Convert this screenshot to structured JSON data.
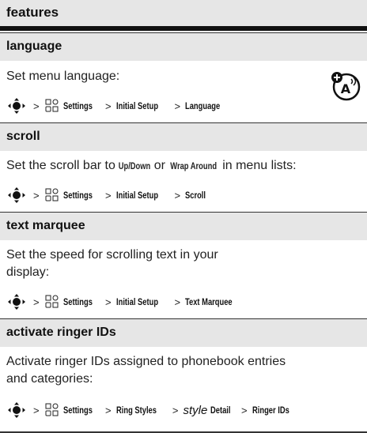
{
  "header": {
    "title": "features"
  },
  "sections": [
    {
      "title": "language",
      "desc": "Set menu language:",
      "path": [
        "Settings",
        "Initial Setup",
        "Language"
      ]
    },
    {
      "title": "scroll",
      "desc_before": "Set the scroll bar to ",
      "desc_opt1": "Up/Down",
      "desc_mid": " or ",
      "desc_opt2": "Wrap Around",
      "desc_after": " in menu lists:",
      "path": [
        "Settings",
        "Initial Setup",
        "Scroll"
      ]
    },
    {
      "title": "text marquee",
      "desc_line1": "Set the speed for scrolling text in your",
      "desc_line2": "display:",
      "path": [
        "Settings",
        "Initial Setup",
        "Text Marquee"
      ]
    },
    {
      "title": "activate ringer IDs",
      "desc_line1": "Activate ringer IDs assigned to phonebook entries",
      "desc_line2": "and categories:",
      "path_a": "Settings",
      "path_b": "Ring Styles",
      "path_c_italic": "style",
      "path_c_rest": "Detail",
      "path_d": "Ringer IDs"
    }
  ],
  "icons": {
    "nav": "nav-key-icon",
    "settings": "settings-icon",
    "badge": "network-feature-icon"
  }
}
